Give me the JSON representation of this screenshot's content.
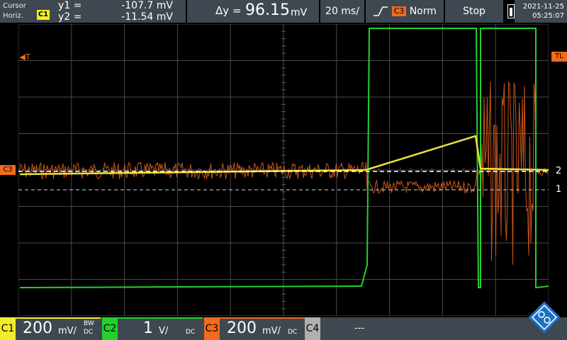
{
  "cursor": {
    "mode_line1": "Cursor",
    "mode_line2": "Horiz.",
    "source": "C1",
    "y1_label": "y1 =",
    "y1_value": "-107.7 mV",
    "y2_label": "y2 =",
    "y2_value": "-11.54 mV",
    "delta_label": "Δy =",
    "delta_value": "96.15",
    "delta_unit": "mV"
  },
  "timebase": "20 ms/",
  "trigger": {
    "source": "C3",
    "mode": "Norm",
    "slope_icon": "rising-edge-icon"
  },
  "run_state": "Stop",
  "datetime": {
    "date": "2021-11-25",
    "time": "05:25:07"
  },
  "markers": {
    "trigger_left": "T",
    "trigger_right": "TL",
    "ch3_offset": "C3",
    "cursor1": "1",
    "cursor2": "2"
  },
  "channels": [
    {
      "name": "C1",
      "scale": "200",
      "unit": "mV/",
      "bw": "BW",
      "coupling": "DC",
      "color": "#f2ec2c"
    },
    {
      "name": "C2",
      "scale": "1",
      "unit": "V/",
      "coupling": "DC",
      "color": "#22d12e"
    },
    {
      "name": "C3",
      "scale": "200",
      "unit": "mV/",
      "coupling": "DC",
      "color": "#f06b1a"
    },
    {
      "name": "C4",
      "scale": "---",
      "coupling": "",
      "color": "#b0b0b0"
    }
  ],
  "colors": {
    "ch1": "#f2ec2c",
    "ch2": "#22d12e",
    "ch3": "#f06b1a",
    "panel": "#3f4750"
  }
}
